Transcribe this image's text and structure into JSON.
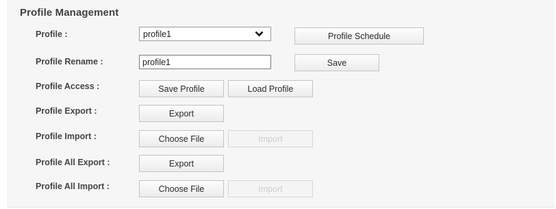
{
  "section_title": "Profile Management",
  "profile": {
    "label": "Profile :",
    "selected": "profile1",
    "schedule_button": "Profile Schedule"
  },
  "rename": {
    "label": "Profile Rename :",
    "value": "profile1",
    "save_button": "Save"
  },
  "access": {
    "label": "Profile Access :",
    "save_button": "Save Profile",
    "load_button": "Load Profile"
  },
  "export": {
    "label": "Profile Export :",
    "button": "Export"
  },
  "import": {
    "label": "Profile Import :",
    "choose_button": "Choose File",
    "import_button": "Import"
  },
  "all_export": {
    "label": "Profile All Export :",
    "button": "Export"
  },
  "all_import": {
    "label": "Profile All Import :",
    "choose_button": "Choose File",
    "import_button": "Import"
  },
  "icons": {
    "dropdown": "chevron-down-icon"
  },
  "colors": {
    "panel_bg": "#f6f6f6",
    "disabled_text": "#cfcfcf"
  }
}
